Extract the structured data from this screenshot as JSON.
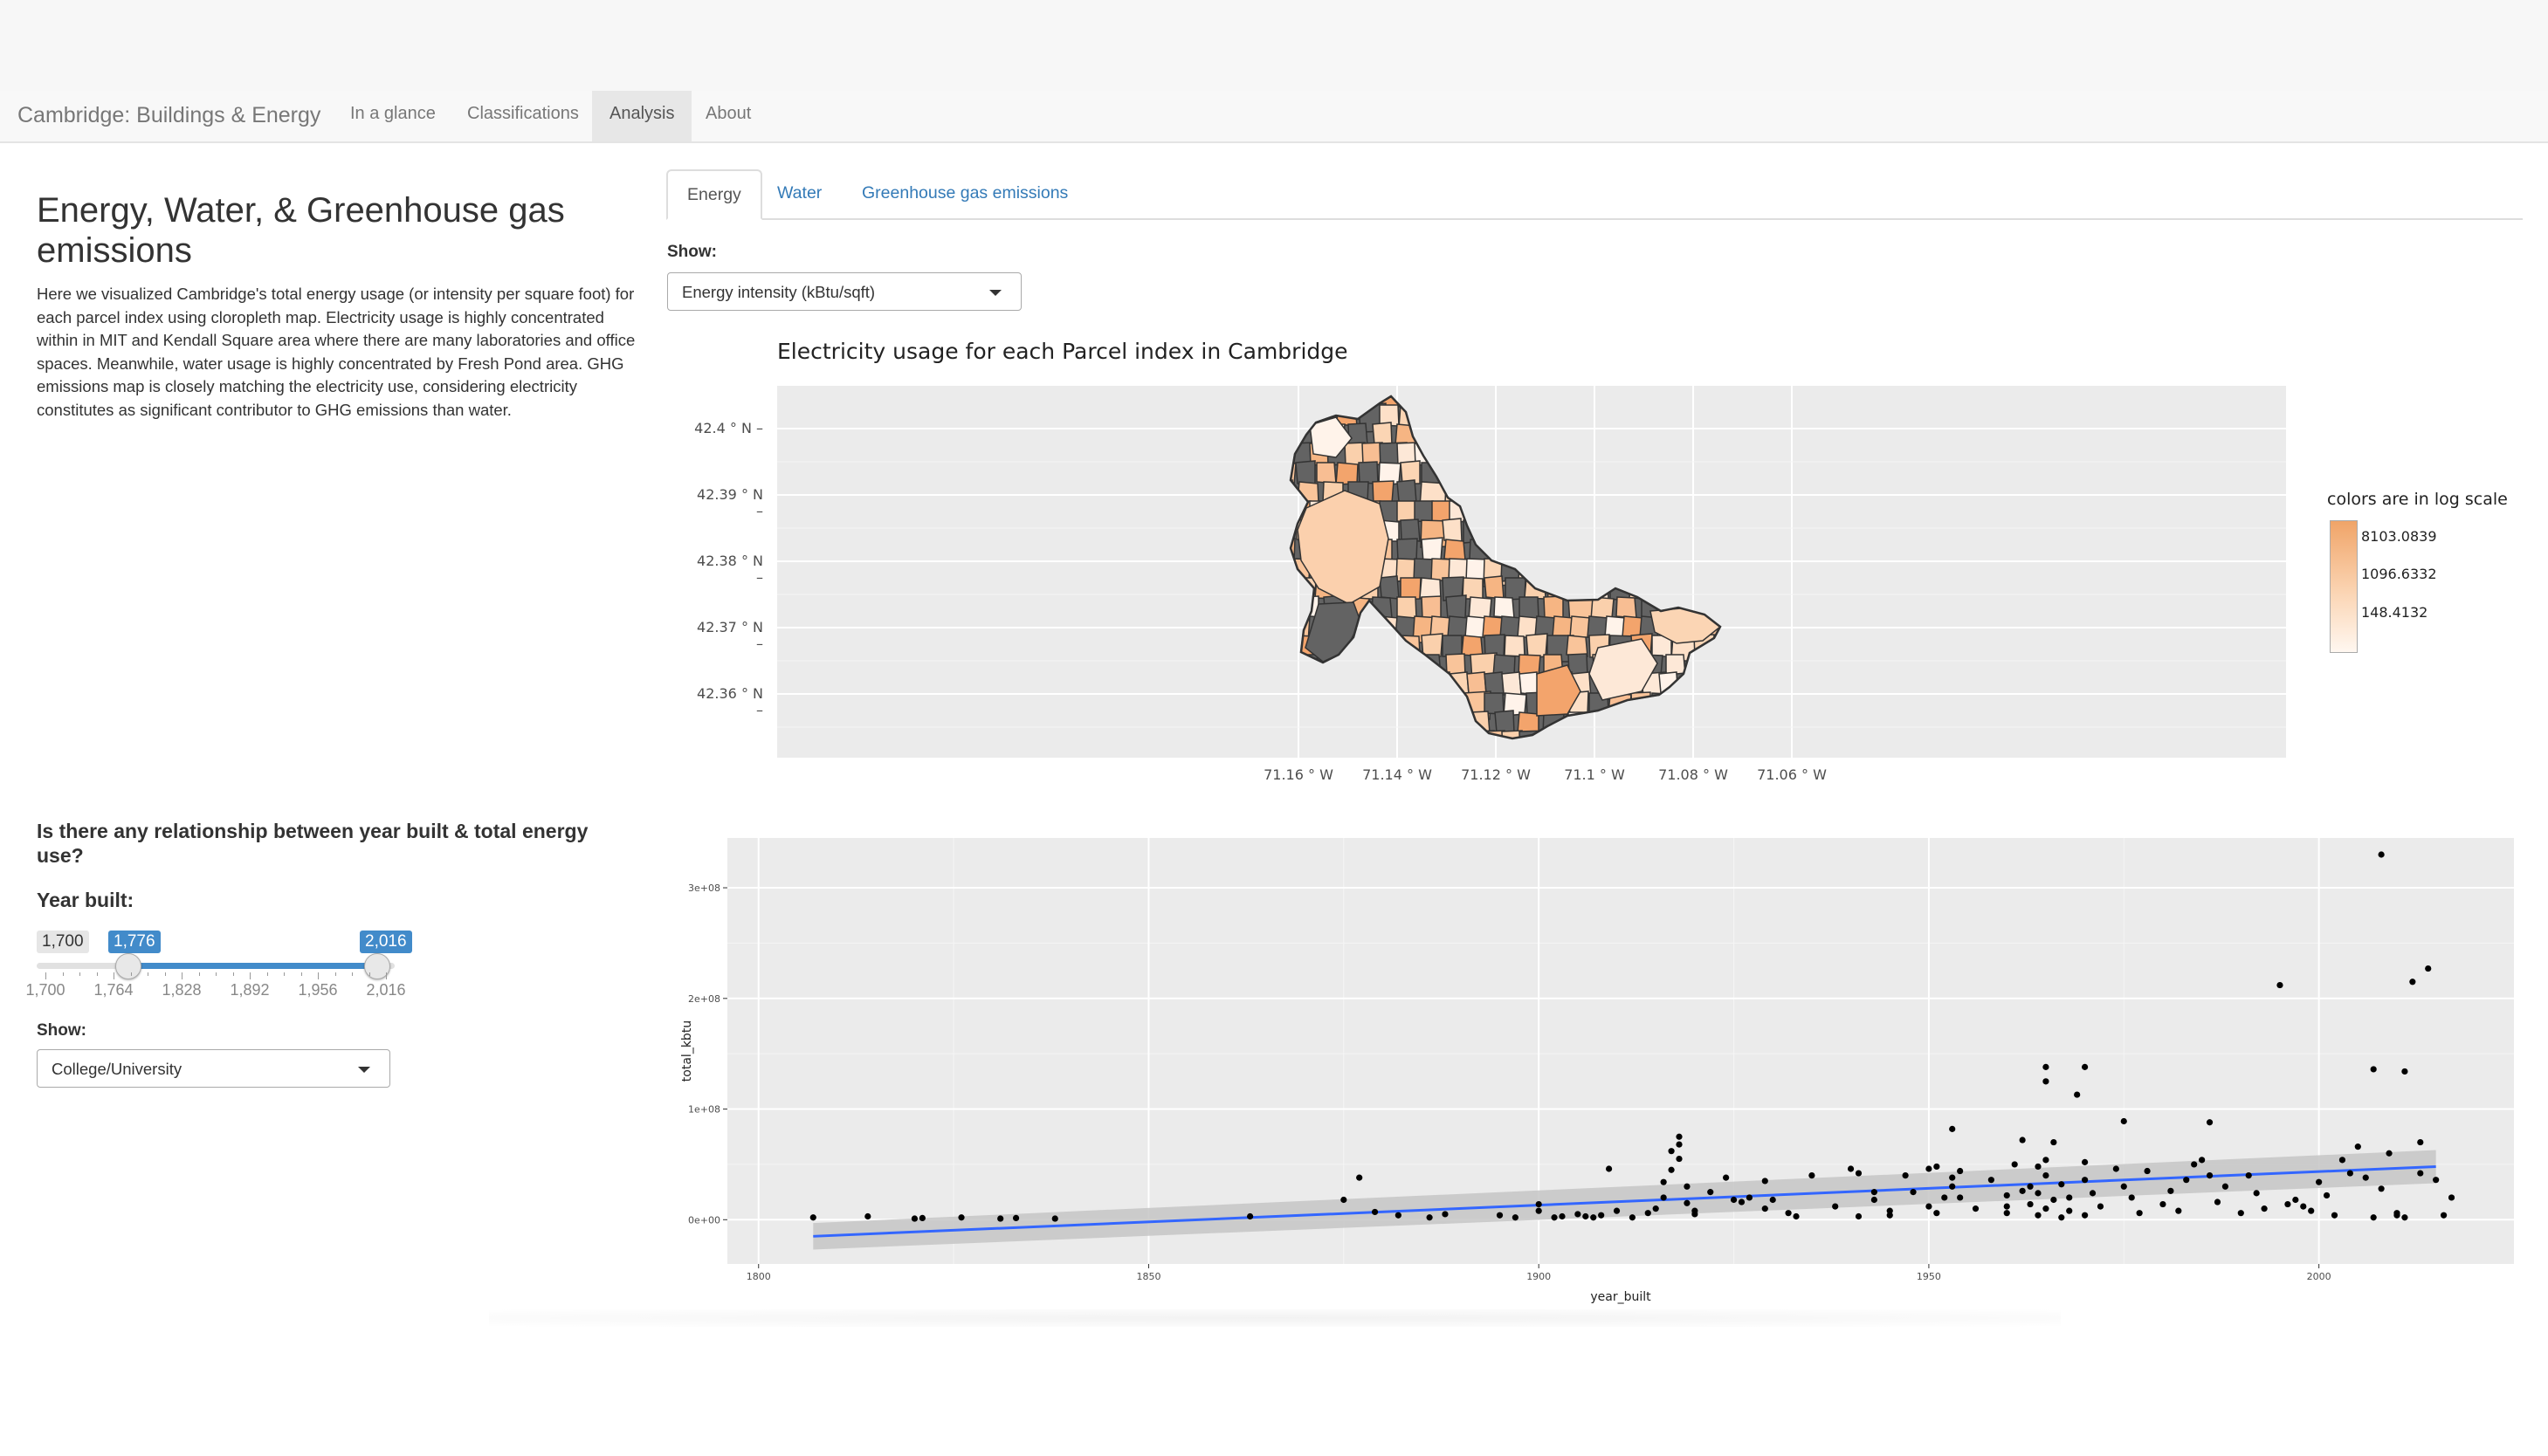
{
  "navbar": {
    "brand": "Cambridge: Buildings & Energy",
    "items": [
      "In a glance",
      "Classifications",
      "Analysis",
      "About"
    ],
    "active": "Analysis"
  },
  "left": {
    "title": "Energy, Water, & Greenhouse gas emissions",
    "paragraph": "Here we visualized Cambridge's total energy usage (or intensity per square foot) for each parcel index using cloropleth map. Electricity usage is highly concentrated within in MIT and Kendall Square area where there are many laboratories and office spaces. Meanwhile, water usage is highly concentrated by Fresh Pond area. GHG emissions map is closely matching the electricity use, considering electricity constitutes as significant contributor to GHG emissions than water.",
    "question": "Is there any relationship between year built & total energy use?",
    "year_label": "Year built:",
    "slider": {
      "min": 1700,
      "max": 2016,
      "from": 1776,
      "to": 2016,
      "min_label": "1,700",
      "from_label": "1,776",
      "to_label": "2,016",
      "tick_labels": [
        "1,700",
        "1,764",
        "1,828",
        "1,892",
        "1,956",
        "2,016"
      ]
    },
    "show_label": "Show:",
    "select_value": "College/University"
  },
  "tabs": [
    "Energy",
    "Water",
    "Greenhouse gas emissions"
  ],
  "active_tab": "Energy",
  "energy_show_label": "Show:",
  "energy_select_value": "Energy intensity (kBtu/sqft)",
  "map": {
    "title": "Electricity usage for each Parcel index in Cambridge",
    "lat_labels": [
      "42.4 ° N",
      "42.39 ° N",
      "42.38 ° N",
      "42.37 ° N",
      "42.36 ° N"
    ],
    "lon_labels": [
      "71.16 ° W",
      "71.14 ° W",
      "71.12 ° W",
      "71.1 ° W",
      "71.08 ° W",
      "71.06 ° W"
    ],
    "legend_title": "colors are in log scale",
    "legend_labels": [
      "8103.0839",
      "1096.6332",
      "148.4132"
    ],
    "colors": {
      "high": "#f0a468",
      "mid": "#fbd5b4",
      "low": "#fff7f0",
      "missing": "#636363",
      "border": "#333333"
    }
  },
  "chart_data": {
    "type": "scatter",
    "xlabel": "year_built",
    "ylabel": "total_kbtu",
    "xlim": [
      1796,
      2025
    ],
    "ylim": [
      -40000000,
      345000000
    ],
    "x_ticks": [
      1800,
      1850,
      1900,
      1950,
      2000
    ],
    "y_ticks": [
      0,
      100000000,
      200000000,
      300000000
    ],
    "y_tick_labels": [
      "0e+00",
      "1e+08",
      "2e+08",
      "3e+08"
    ],
    "trend": {
      "x": [
        1807,
        2015
      ],
      "y": [
        -15000000,
        48000000
      ],
      "color": "#3366ff"
    },
    "points": [
      [
        1807,
        2000000
      ],
      [
        1814,
        3000000
      ],
      [
        1820,
        1000000
      ],
      [
        1821,
        1500000
      ],
      [
        1826,
        2000000
      ],
      [
        1831,
        1000000
      ],
      [
        1833,
        1500000
      ],
      [
        1838,
        1000000
      ],
      [
        1863,
        3000000
      ],
      [
        1875,
        18000000
      ],
      [
        1877,
        38000000
      ],
      [
        1879,
        7000000
      ],
      [
        1882,
        4000000
      ],
      [
        1886,
        2000000
      ],
      [
        1888,
        5000000
      ],
      [
        1895,
        4000000
      ],
      [
        1897,
        2000000
      ],
      [
        1900,
        14000000
      ],
      [
        1900,
        8000000
      ],
      [
        1902,
        2000000
      ],
      [
        1903,
        3000000
      ],
      [
        1905,
        5000000
      ],
      [
        1906,
        3000000
      ],
      [
        1907,
        2000000
      ],
      [
        1908,
        4000000
      ],
      [
        1909,
        46000000
      ],
      [
        1910,
        8000000
      ],
      [
        1912,
        2000000
      ],
      [
        1914,
        6000000
      ],
      [
        1915,
        10000000
      ],
      [
        1916,
        34000000
      ],
      [
        1916,
        20000000
      ],
      [
        1917,
        45000000
      ],
      [
        1917,
        62000000
      ],
      [
        1918,
        75000000
      ],
      [
        1918,
        68000000
      ],
      [
        1918,
        55000000
      ],
      [
        1919,
        30000000
      ],
      [
        1919,
        15000000
      ],
      [
        1920,
        8000000
      ],
      [
        1920,
        5000000
      ],
      [
        1922,
        25000000
      ],
      [
        1924,
        38000000
      ],
      [
        1925,
        18000000
      ],
      [
        1926,
        16000000
      ],
      [
        1927,
        20000000
      ],
      [
        1929,
        10000000
      ],
      [
        1929,
        35000000
      ],
      [
        1930,
        18000000
      ],
      [
        1932,
        6000000
      ],
      [
        1933,
        3000000
      ],
      [
        1935,
        40000000
      ],
      [
        1938,
        12000000
      ],
      [
        1940,
        46000000
      ],
      [
        1941,
        42000000
      ],
      [
        1941,
        3000000
      ],
      [
        1943,
        25000000
      ],
      [
        1943,
        18000000
      ],
      [
        1945,
        8000000
      ],
      [
        1945,
        4000000
      ],
      [
        1947,
        40000000
      ],
      [
        1948,
        25000000
      ],
      [
        1950,
        12000000
      ],
      [
        1950,
        46000000
      ],
      [
        1951,
        6000000
      ],
      [
        1951,
        48000000
      ],
      [
        1952,
        20000000
      ],
      [
        1953,
        38000000
      ],
      [
        1953,
        82000000
      ],
      [
        1953,
        30000000
      ],
      [
        1954,
        44000000
      ],
      [
        1954,
        20000000
      ],
      [
        1956,
        10000000
      ],
      [
        1958,
        36000000
      ],
      [
        1960,
        22000000
      ],
      [
        1960,
        12000000
      ],
      [
        1960,
        6000000
      ],
      [
        1961,
        50000000
      ],
      [
        1962,
        26000000
      ],
      [
        1962,
        72000000
      ],
      [
        1963,
        14000000
      ],
      [
        1963,
        30000000
      ],
      [
        1964,
        48000000
      ],
      [
        1964,
        24000000
      ],
      [
        1964,
        4000000
      ],
      [
        1965,
        54000000
      ],
      [
        1965,
        125000000
      ],
      [
        1965,
        138000000
      ],
      [
        1965,
        40000000
      ],
      [
        1965,
        10000000
      ],
      [
        1966,
        70000000
      ],
      [
        1966,
        18000000
      ],
      [
        1967,
        2000000
      ],
      [
        1967,
        32000000
      ],
      [
        1968,
        8000000
      ],
      [
        1968,
        20000000
      ],
      [
        1969,
        113000000
      ],
      [
        1970,
        138000000
      ],
      [
        1970,
        52000000
      ],
      [
        1970,
        36000000
      ],
      [
        1970,
        4000000
      ],
      [
        1971,
        24000000
      ],
      [
        1972,
        12000000
      ],
      [
        1974,
        46000000
      ],
      [
        1975,
        89000000
      ],
      [
        1975,
        30000000
      ],
      [
        1976,
        20000000
      ],
      [
        1977,
        6000000
      ],
      [
        1978,
        44000000
      ],
      [
        1980,
        14000000
      ],
      [
        1981,
        26000000
      ],
      [
        1982,
        8000000
      ],
      [
        1983,
        36000000
      ],
      [
        1984,
        50000000
      ],
      [
        1985,
        54000000
      ],
      [
        1986,
        88000000
      ],
      [
        1986,
        40000000
      ],
      [
        1987,
        16000000
      ],
      [
        1988,
        30000000
      ],
      [
        1990,
        6000000
      ],
      [
        1991,
        40000000
      ],
      [
        1992,
        24000000
      ],
      [
        1993,
        10000000
      ],
      [
        1995,
        212000000
      ],
      [
        1996,
        14000000
      ],
      [
        1997,
        18000000
      ],
      [
        1998,
        12000000
      ],
      [
        1999,
        8000000
      ],
      [
        2000,
        34000000
      ],
      [
        2001,
        22000000
      ],
      [
        2002,
        4000000
      ],
      [
        2003,
        54000000
      ],
      [
        2004,
        42000000
      ],
      [
        2005,
        66000000
      ],
      [
        2006,
        38000000
      ],
      [
        2007,
        136000000
      ],
      [
        2007,
        2000000
      ],
      [
        2008,
        28000000
      ],
      [
        2008,
        330000000
      ],
      [
        2009,
        60000000
      ],
      [
        2010,
        4000000
      ],
      [
        2010,
        6000000
      ],
      [
        2011,
        134000000
      ],
      [
        2011,
        2000000
      ],
      [
        2012,
        215000000
      ],
      [
        2013,
        70000000
      ],
      [
        2013,
        42000000
      ],
      [
        2014,
        227000000
      ],
      [
        2015,
        36000000
      ],
      [
        2016,
        4000000
      ],
      [
        2017,
        20000000
      ]
    ]
  }
}
